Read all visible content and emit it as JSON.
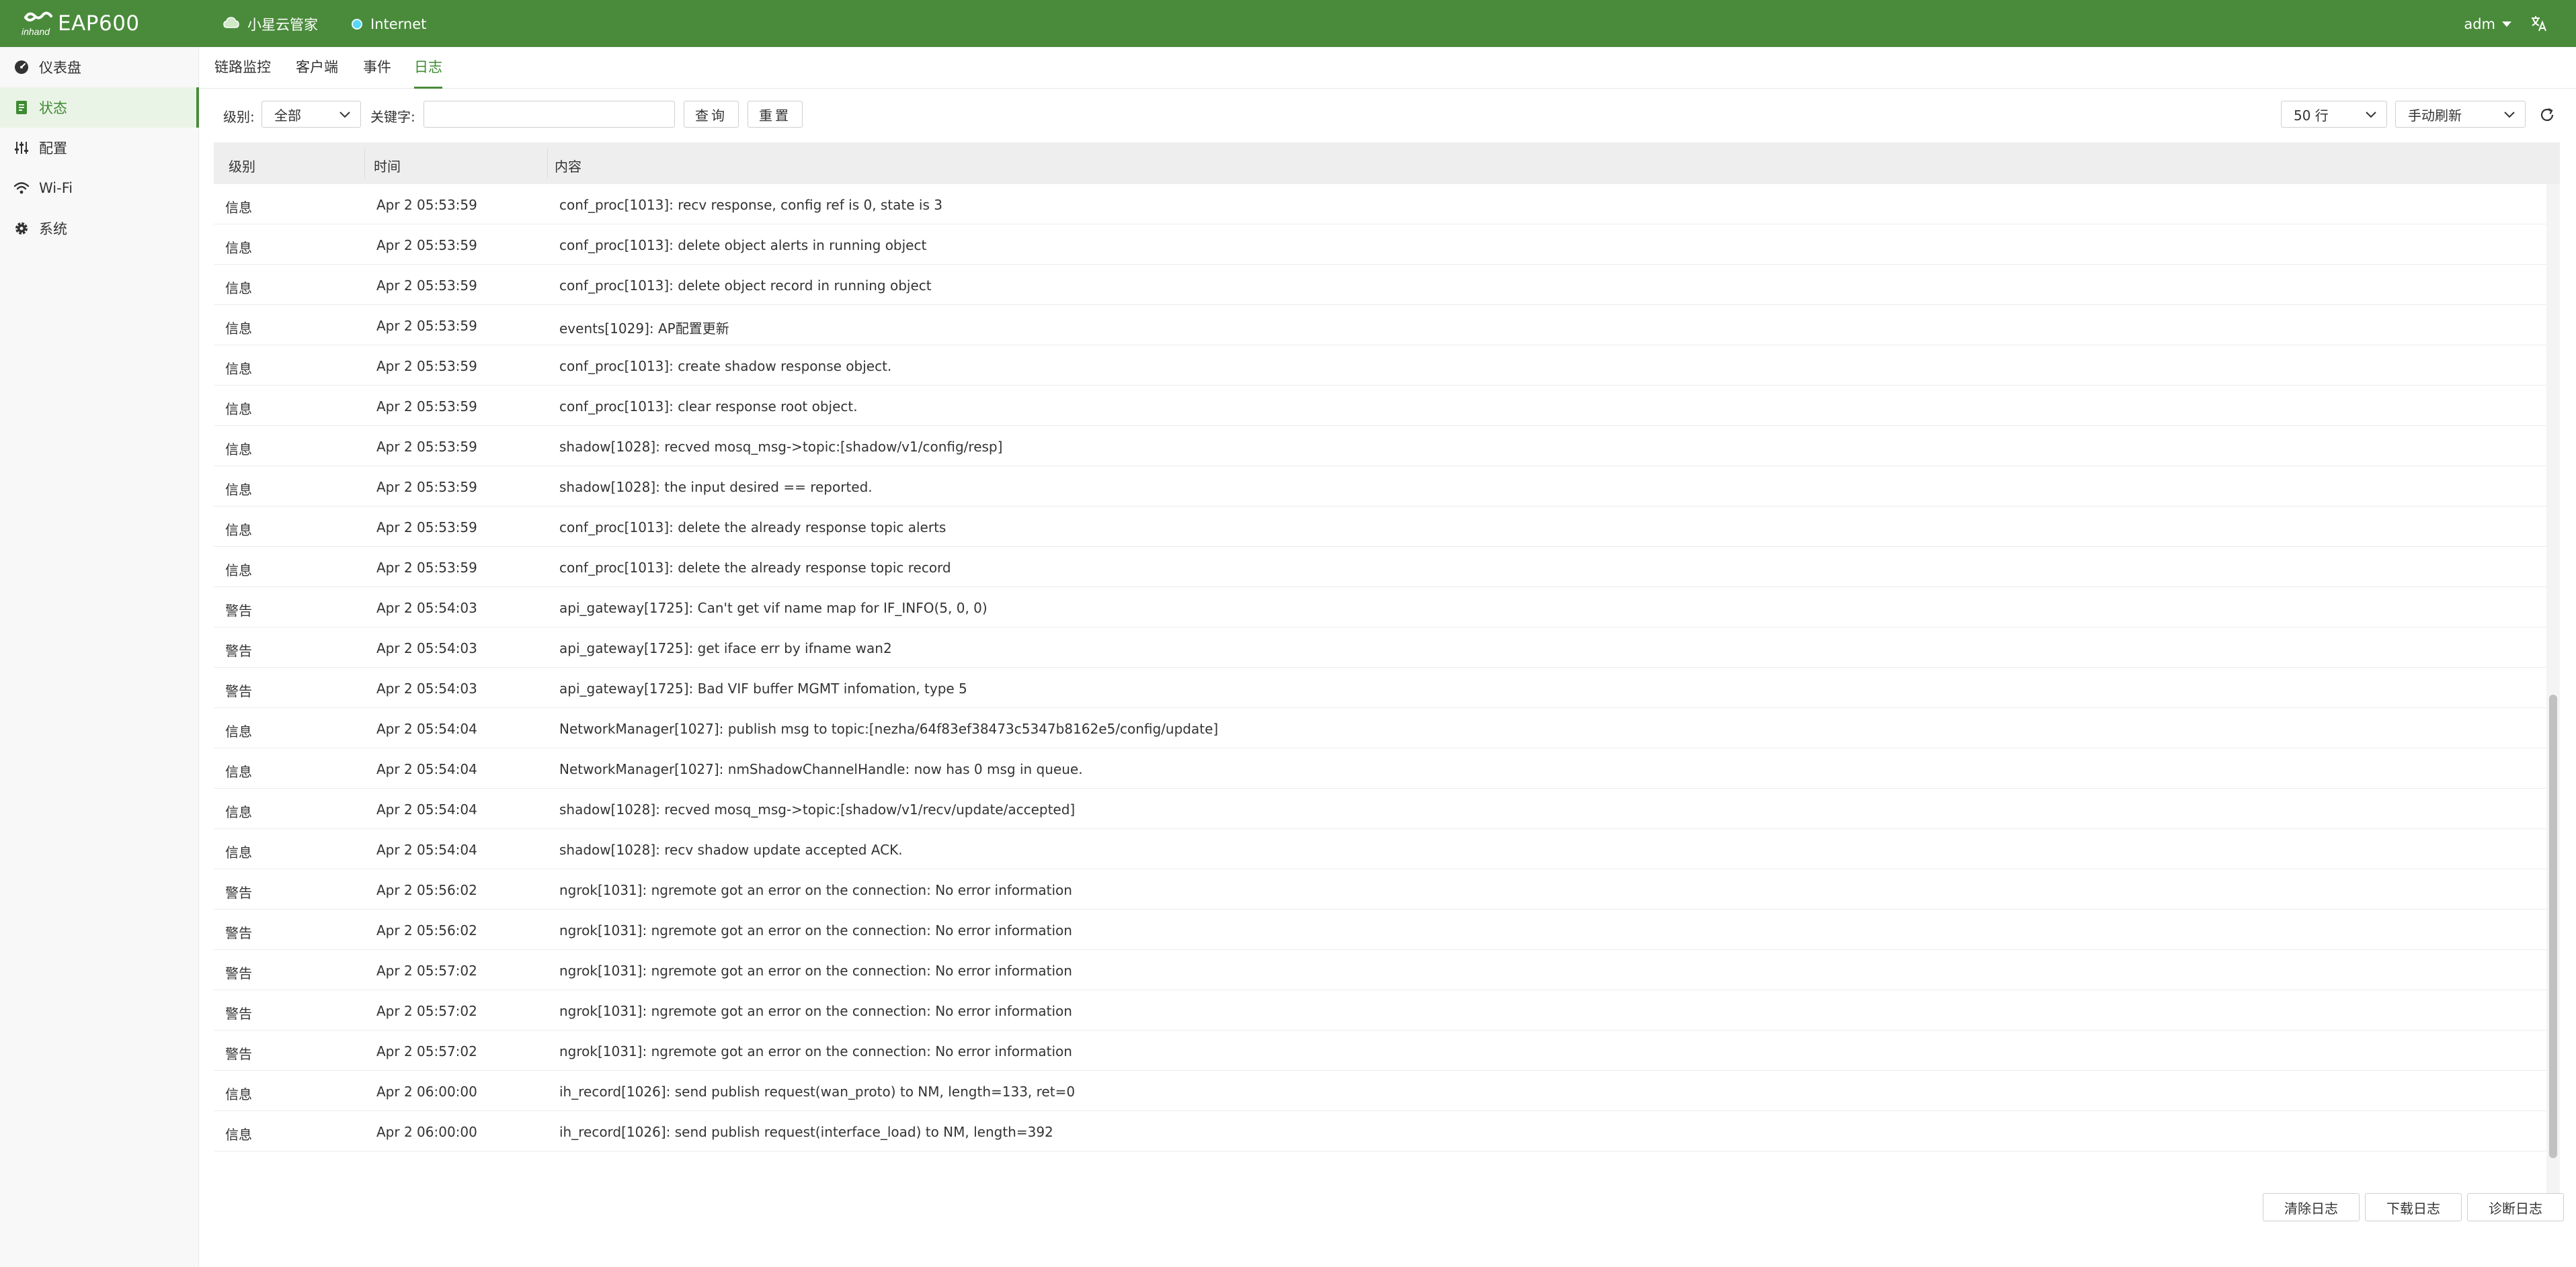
{
  "header": {
    "brand_small": "inhand",
    "brand": "EAP600",
    "cloud_label": "小星云管家",
    "internet_label": "Internet",
    "user": "adm",
    "colors": {
      "header_bg": "#4a8b3b",
      "status_dot": "#54d8f5"
    },
    "icons": [
      "cloud-icon",
      "status-dot-icon",
      "language-icon"
    ]
  },
  "sidebar": {
    "items": [
      {
        "label": "仪表盘",
        "icon": "dashboard-icon"
      },
      {
        "label": "状态",
        "icon": "status-icon",
        "active": true
      },
      {
        "label": "配置",
        "icon": "config-icon"
      },
      {
        "label": "Wi-Fi",
        "icon": "wifi-icon"
      },
      {
        "label": "系统",
        "icon": "gear-icon"
      }
    ]
  },
  "tabs": [
    {
      "label": "链路监控"
    },
    {
      "label": "客户端"
    },
    {
      "label": "事件"
    },
    {
      "label": "日志",
      "active": true
    }
  ],
  "filters": {
    "level_label": "级别:",
    "level_value": "全部",
    "keyword_label": "关键字:",
    "keyword_value": "",
    "query_label": "查询",
    "reset_label": "重置",
    "rows_value": "50 行",
    "refresh_mode": "手动刷新"
  },
  "table": {
    "columns": [
      "级别",
      "时间",
      "内容"
    ],
    "rows": [
      {
        "level": "信息",
        "time": "Apr 2 05:53:59",
        "content": "conf_proc[1013]: recv response, config ref is 0, state is 3"
      },
      {
        "level": "信息",
        "time": "Apr 2 05:53:59",
        "content": "conf_proc[1013]: delete object alerts in running object"
      },
      {
        "level": "信息",
        "time": "Apr 2 05:53:59",
        "content": "conf_proc[1013]: delete object record in running object"
      },
      {
        "level": "信息",
        "time": "Apr 2 05:53:59",
        "content": "events[1029]: AP配置更新"
      },
      {
        "level": "信息",
        "time": "Apr 2 05:53:59",
        "content": "conf_proc[1013]: create shadow response object."
      },
      {
        "level": "信息",
        "time": "Apr 2 05:53:59",
        "content": "conf_proc[1013]: clear response root object."
      },
      {
        "level": "信息",
        "time": "Apr 2 05:53:59",
        "content": "shadow[1028]: recved mosq_msg->topic:[shadow/v1/config/resp]"
      },
      {
        "level": "信息",
        "time": "Apr 2 05:53:59",
        "content": "shadow[1028]: the input desired == reported."
      },
      {
        "level": "信息",
        "time": "Apr 2 05:53:59",
        "content": "conf_proc[1013]: delete the already response topic alerts"
      },
      {
        "level": "信息",
        "time": "Apr 2 05:53:59",
        "content": "conf_proc[1013]: delete the already response topic record"
      },
      {
        "level": "警告",
        "time": "Apr 2 05:54:03",
        "content": "api_gateway[1725]: Can't get vif name map for IF_INFO(5, 0, 0)"
      },
      {
        "level": "警告",
        "time": "Apr 2 05:54:03",
        "content": "api_gateway[1725]: get iface err by ifname wan2"
      },
      {
        "level": "警告",
        "time": "Apr 2 05:54:03",
        "content": "api_gateway[1725]: Bad VIF buffer MGMT infomation, type 5"
      },
      {
        "level": "信息",
        "time": "Apr 2 05:54:04",
        "content": "NetworkManager[1027]: publish msg to topic:[nezha/64f83ef38473c5347b8162e5/config/update]"
      },
      {
        "level": "信息",
        "time": "Apr 2 05:54:04",
        "content": "NetworkManager[1027]: nmShadowChannelHandle: now has 0 msg in queue."
      },
      {
        "level": "信息",
        "time": "Apr 2 05:54:04",
        "content": "shadow[1028]: recved mosq_msg->topic:[shadow/v1/recv/update/accepted]"
      },
      {
        "level": "信息",
        "time": "Apr 2 05:54:04",
        "content": "shadow[1028]: recv shadow update accepted ACK."
      },
      {
        "level": "警告",
        "time": "Apr 2 05:56:02",
        "content": "ngrok[1031]: ngremote got an error on the connection: No error information"
      },
      {
        "level": "警告",
        "time": "Apr 2 05:56:02",
        "content": "ngrok[1031]: ngremote got an error on the connection: No error information"
      },
      {
        "level": "警告",
        "time": "Apr 2 05:57:02",
        "content": "ngrok[1031]: ngremote got an error on the connection: No error information"
      },
      {
        "level": "警告",
        "time": "Apr 2 05:57:02",
        "content": "ngrok[1031]: ngremote got an error on the connection: No error information"
      },
      {
        "level": "警告",
        "time": "Apr 2 05:57:02",
        "content": "ngrok[1031]: ngremote got an error on the connection: No error information"
      },
      {
        "level": "信息",
        "time": "Apr 2 06:00:00",
        "content": "ih_record[1026]: send publish request(wan_proto) to NM, length=133, ret=0"
      },
      {
        "level": "信息",
        "time": "Apr 2 06:00:00",
        "content": "ih_record[1026]: send publish request(interface_load) to NM, length=392"
      }
    ]
  },
  "footer": {
    "clear_label": "清除日志",
    "download_label": "下载日志",
    "diagnose_label": "诊断日志"
  }
}
